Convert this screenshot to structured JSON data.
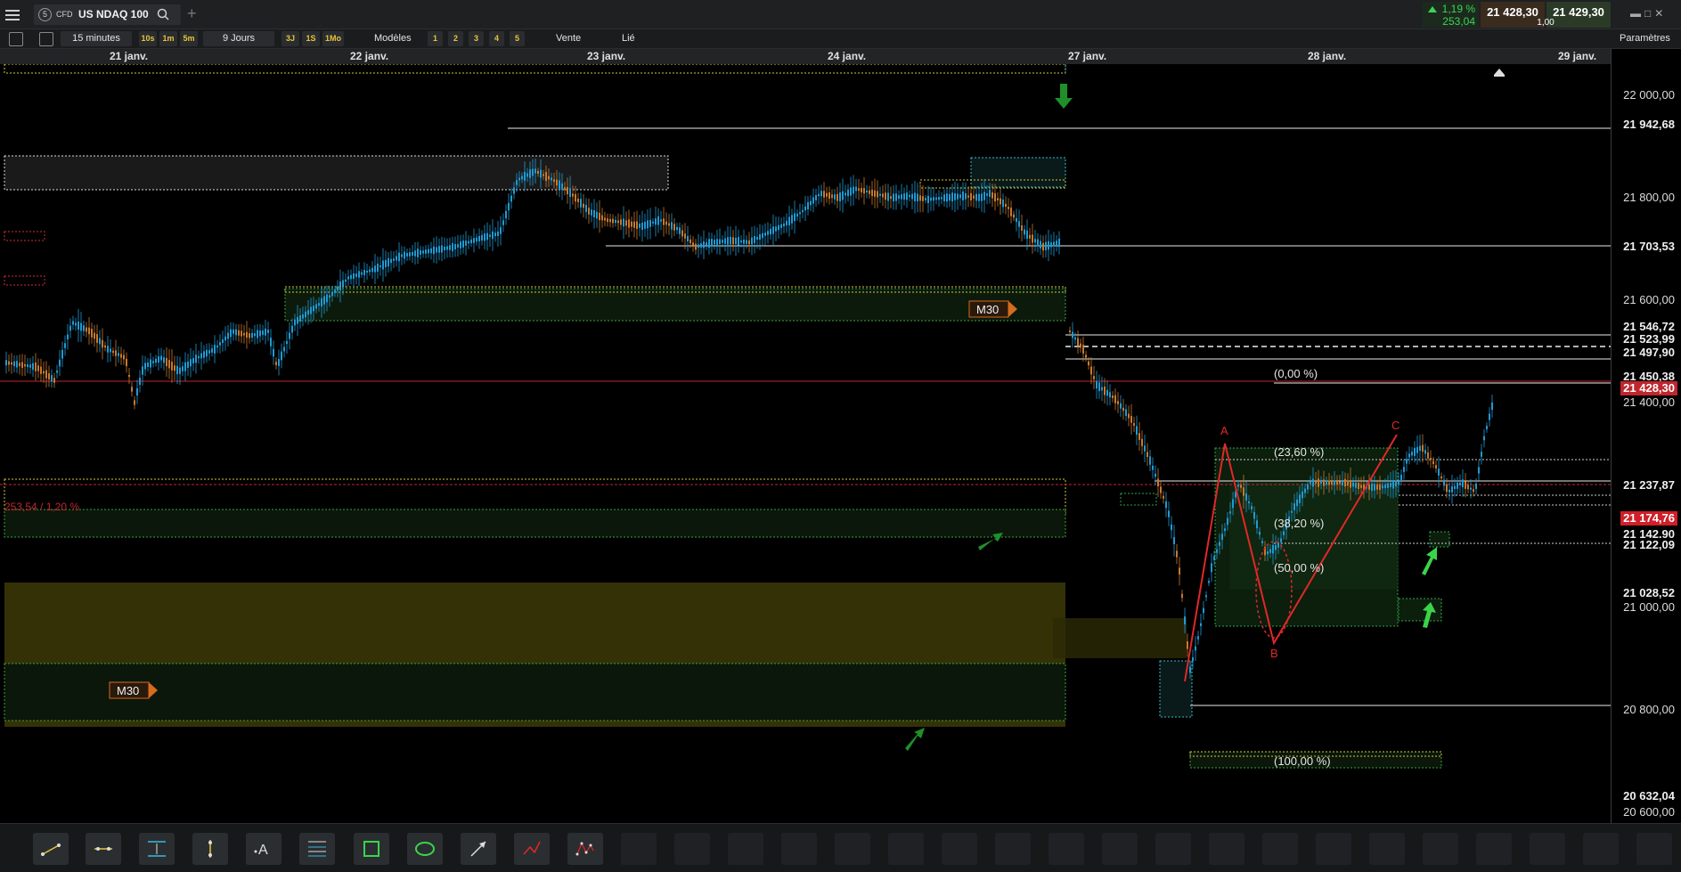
{
  "header": {
    "symbol_badge": "5",
    "symbol_type": "CFD",
    "symbol_name": "US NDAQ 100",
    "change_pct": "1,19 %",
    "change_pts": "253,04",
    "bid": "21 428,30",
    "ask": "21 429,30",
    "spread": "1,00",
    "accent_up": "#3bd35a"
  },
  "toolbar": {
    "interval": "15 minutes",
    "quick_intervals": [
      "10s",
      "1m",
      "5m"
    ],
    "range": "9 Jours",
    "quick_ranges": [
      "3J",
      "1S",
      "1Mo"
    ],
    "templates_label": "Modèles",
    "template_slots": [
      "1",
      "2",
      "3",
      "4",
      "5"
    ],
    "sell_label": "Vente",
    "link_label": "Lié",
    "settings_label": "Paramètres"
  },
  "chart_data": {
    "type": "candlestick",
    "x_axis": {
      "type": "date",
      "tick_labels": [
        "21 janv.",
        "22 janv.",
        "23 janv.",
        "24 janv.",
        "27 janv.",
        "28 janv.",
        "29 janv."
      ]
    },
    "y_axis": {
      "range": [
        20580,
        22060
      ],
      "tick_labels": [
        "22 000,00",
        "21 800,00",
        "21 600,00",
        "21 400,00",
        "21 000,00",
        "20 800,00",
        "20 600,00"
      ]
    },
    "price_levels": [
      "21 942,68",
      "21 703,53",
      "21 546,72",
      "21 523,99",
      "21 497,90",
      "21 450,38",
      "21 237,87",
      "21 142,90",
      "21 122,09",
      "21 028,52",
      "20 632,04"
    ],
    "current_price": "21 428,30",
    "reference_price": "21 174,76",
    "daily_change_label": "253,54 / 1,20 %",
    "fibonacci_labels": [
      "(0,00 %)",
      "(23,60 %)",
      "(38,20 %)",
      "(50,00 %)",
      "(100,00 %)"
    ],
    "abc_labels": [
      "A",
      "B",
      "C"
    ],
    "zone_labels": [
      "M30",
      "M30"
    ],
    "colors": {
      "bull": "#1e9bd6",
      "bear": "#c77a2e",
      "current_line": "#c0262e",
      "fib_zone": "#2fa34a",
      "yellow_zone": "#6b6010",
      "arrows": "#2db33a"
    }
  },
  "bottom_tools": [
    "trend-line-icon",
    "horizontal-line-icon",
    "price-range-icon",
    "vertical-line-icon",
    "text-annotation-icon",
    "fibonacci-icon",
    "rectangle-icon",
    "ellipse-icon",
    "arrow-icon",
    "polyline-icon",
    "pattern-icon"
  ]
}
